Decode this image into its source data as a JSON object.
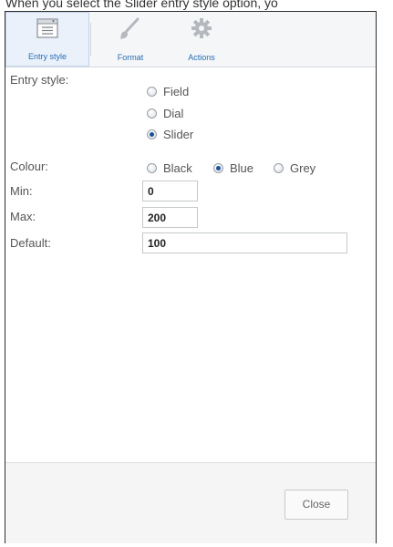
{
  "caption": "When you select the Slider entry style option, yo",
  "toolbar": {
    "entry_style": "Entry style",
    "format": "Format",
    "actions": "Actions"
  },
  "form": {
    "entry_style_label": "Entry style:",
    "entry_style_options": [
      "Field",
      "Dial",
      "Slider"
    ],
    "entry_style_selected": "Slider",
    "colour_label": "Colour:",
    "colour_options": [
      "Black",
      "Blue",
      "Grey"
    ],
    "colour_selected": "Blue",
    "min_label": "Min:",
    "min_value": "0",
    "max_label": "Max:",
    "max_value": "200",
    "default_label": "Default:",
    "default_value": "100"
  },
  "footer": {
    "close_label": "Close"
  },
  "icons": {
    "entry_style": "entry-style-icon",
    "format": "brush-icon",
    "actions": "gear-icon"
  },
  "colors": {
    "link": "#2a6db5",
    "radio_selected": "#1d4f9a"
  }
}
